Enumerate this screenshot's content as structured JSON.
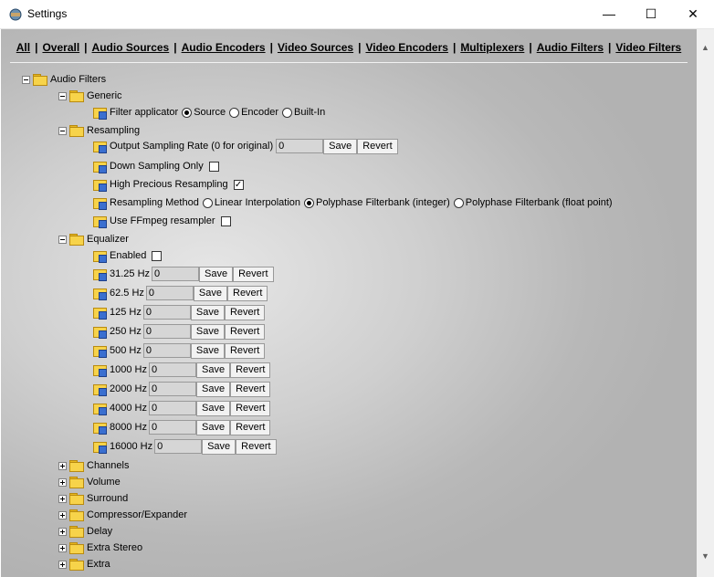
{
  "window": {
    "title": "Settings",
    "minimize": "—",
    "maximize": "☐",
    "close": "✕"
  },
  "nav": [
    "All",
    "Overall",
    "Audio Sources",
    "Audio Encoders",
    "Video Sources",
    "Video Encoders",
    "Multiplexers",
    "Audio Filters",
    "Video Filters"
  ],
  "tree": {
    "root": "Audio Filters",
    "generic": {
      "label": "Generic",
      "filter_applicator": "Filter applicator",
      "options": [
        "Source",
        "Encoder",
        "Built-In"
      ],
      "selected": "Source"
    },
    "resampling": {
      "label": "Resampling",
      "output_rate_label": "Output Sampling Rate (0 for original)",
      "output_rate_value": "0",
      "save": "Save",
      "revert": "Revert",
      "down_sampling_label": "Down Sampling Only",
      "down_sampling_checked": false,
      "high_precious_label": "High Precious Resampling",
      "high_precious_checked": true,
      "method_label": "Resampling Method",
      "methods": [
        "Linear Interpolation",
        "Polyphase Filterbank (integer)",
        "Polyphase Filterbank (float point)"
      ],
      "method_selected": "Polyphase Filterbank (integer)",
      "ffmpeg_label": "Use FFmpeg resampler",
      "ffmpeg_checked": false
    },
    "equalizer": {
      "label": "Equalizer",
      "enabled_label": "Enabled",
      "enabled_checked": false,
      "bands": [
        {
          "label": "31.25 Hz",
          "value": "0"
        },
        {
          "label": "62.5 Hz",
          "value": "0"
        },
        {
          "label": "125 Hz",
          "value": "0"
        },
        {
          "label": "250 Hz",
          "value": "0"
        },
        {
          "label": "500 Hz",
          "value": "0"
        },
        {
          "label": "1000 Hz",
          "value": "0"
        },
        {
          "label": "2000 Hz",
          "value": "0"
        },
        {
          "label": "4000 Hz",
          "value": "0"
        },
        {
          "label": "8000 Hz",
          "value": "0"
        },
        {
          "label": "16000 Hz",
          "value": "0"
        }
      ]
    },
    "collapsed": [
      "Channels",
      "Volume",
      "Surround",
      "Compressor/Expander",
      "Delay",
      "Extra Stereo",
      "Extra"
    ]
  },
  "check_mark": "✓"
}
